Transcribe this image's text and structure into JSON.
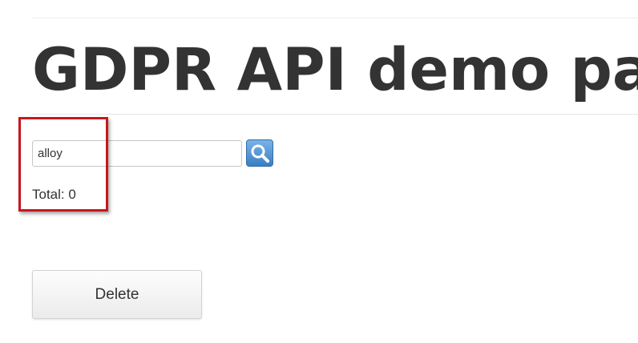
{
  "page": {
    "title": "GDPR API demo pa"
  },
  "search": {
    "value": "alloy",
    "button_icon": "magnifier-icon"
  },
  "results": {
    "total_text": "Total: 0"
  },
  "actions": {
    "delete_label": "Delete"
  },
  "colors": {
    "highlight": "#c8161d",
    "search_button": "#3a7fc2",
    "title_text": "#333333"
  }
}
